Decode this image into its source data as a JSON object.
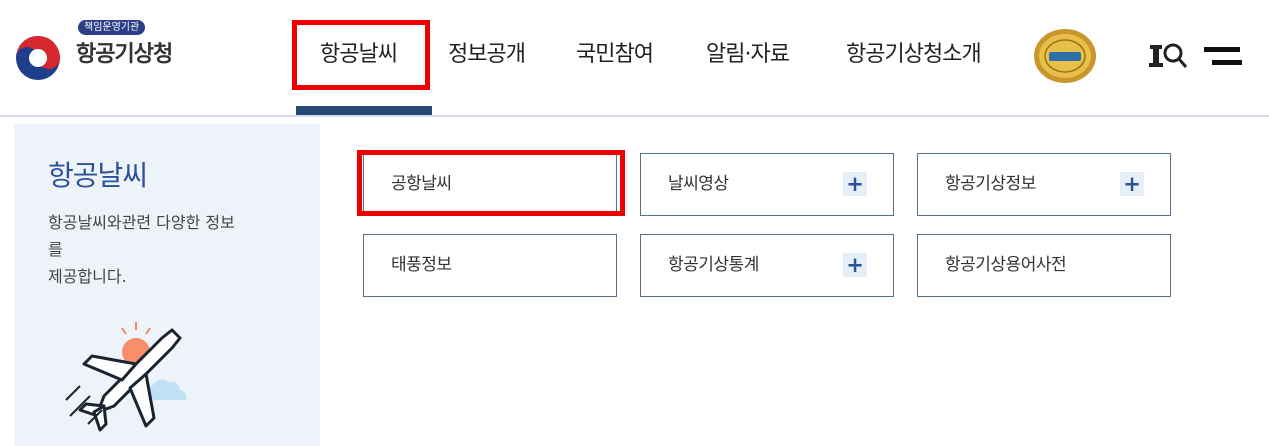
{
  "header": {
    "logo_badge": "책임운영기관",
    "logo_text": "항공기상청",
    "nav": [
      {
        "label": "항공날씨"
      },
      {
        "label": "정보공개"
      },
      {
        "label": "국민참여"
      },
      {
        "label": "알림·자료"
      },
      {
        "label": "항공기상청소개"
      }
    ],
    "active_index": 0,
    "utility_icons": [
      "search-icon",
      "menu-icon"
    ],
    "emblem_icon": "award-emblem-icon"
  },
  "side": {
    "title": "항공날씨",
    "desc_line1": "항공날씨와관련 다양한 정보",
    "desc_line2": "를",
    "desc_line3": "제공합니다.",
    "illustration": "airplane-icon"
  },
  "submenu": [
    {
      "label": "공항날씨",
      "has_plus": false,
      "highlighted": true
    },
    {
      "label": "날씨영상",
      "has_plus": true
    },
    {
      "label": "항공기상정보",
      "has_plus": true
    },
    {
      "label": "태풍정보",
      "has_plus": false
    },
    {
      "label": "항공기상통계",
      "has_plus": true
    },
    {
      "label": "항공기상용어사전",
      "has_plus": false
    }
  ],
  "plus_symbol": "+",
  "colors": {
    "accent_blue": "#2a5298",
    "active_bar": "#264a78",
    "highlight_red": "#ee0000",
    "panel_bg": "#eef3fa"
  }
}
